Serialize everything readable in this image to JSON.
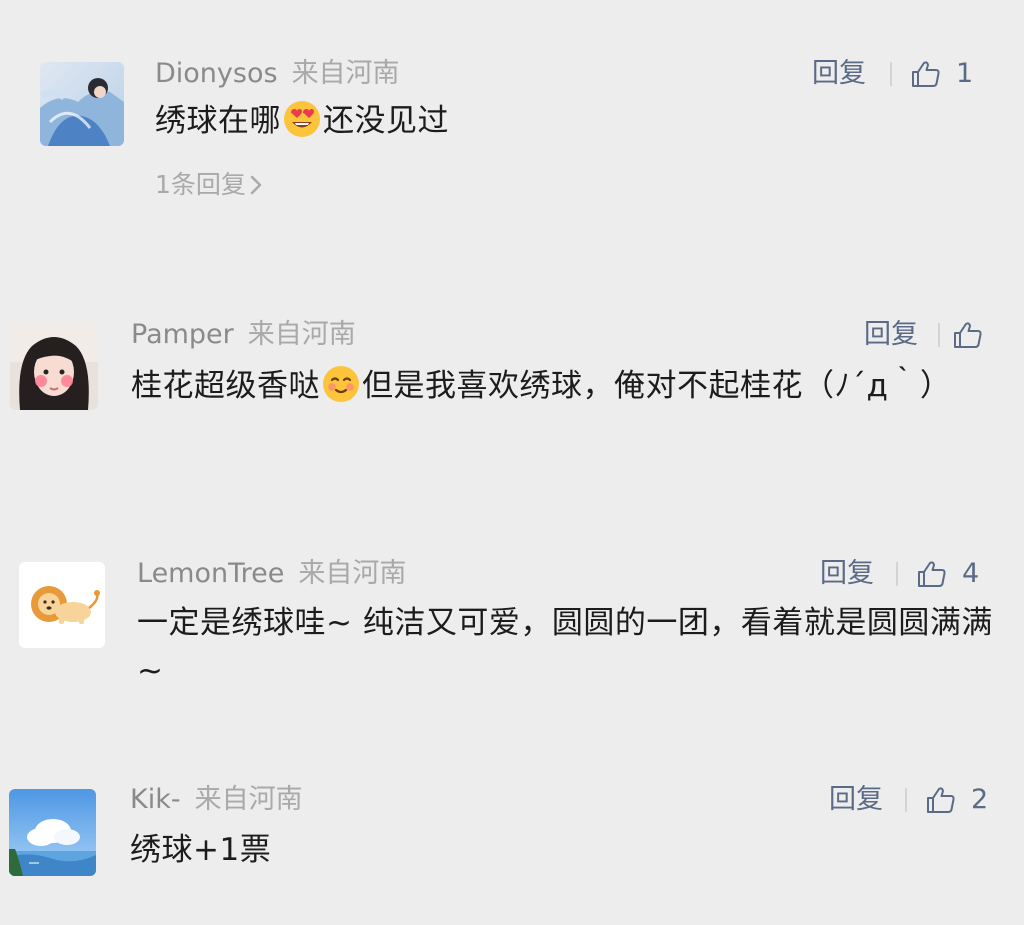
{
  "comments": [
    {
      "nickname": "Dionysos",
      "location": "来自河南",
      "text_before": "绣球在哪",
      "emoji": "heart-eyes-emoji",
      "text_after": "还没见过",
      "replies_label": "1条回复",
      "reply_label": "回复",
      "likes": "1"
    },
    {
      "nickname": "Pamper",
      "location": "来自河南",
      "text_before": "桂花超级香哒",
      "emoji": "smiling-face-emoji",
      "text_after": "但是我喜欢绣球，俺对不起桂花（ﾉ´д｀）",
      "reply_label": "回复",
      "likes": ""
    },
    {
      "nickname": "LemonTree",
      "location": "来自河南",
      "text": "一定是绣球哇~ 纯洁又可爱，圆圆的一团，看着就是圆圆满满~",
      "reply_label": "回复",
      "likes": "4"
    },
    {
      "nickname": "Kik-",
      "location": "来自河南",
      "text": "绣球+1票",
      "reply_label": "回复",
      "likes": "2"
    }
  ],
  "colors": {
    "background": "#ededed",
    "nickname": "#8a8a8a",
    "location": "#a9a9a9",
    "action": "#5b6a86",
    "text": "#1c1c1c"
  },
  "icons": {
    "like": "thumbs-up-outline-icon",
    "chevron": "chevron-right-icon"
  }
}
